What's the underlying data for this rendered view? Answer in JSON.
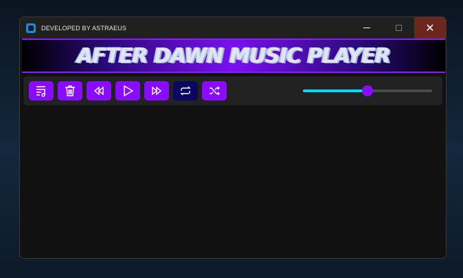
{
  "window": {
    "title": "DEVELOPED BY ASTRAEUS",
    "close_glyph": "✕"
  },
  "banner": {
    "title": "AFTER DAWN MUSIC PLAYER"
  },
  "toolbar": {
    "buttons": [
      {
        "name": "playlist",
        "icon": "playlist-icon"
      },
      {
        "name": "delete",
        "icon": "trash-icon"
      },
      {
        "name": "previous",
        "icon": "rewind-icon"
      },
      {
        "name": "play",
        "icon": "play-icon"
      },
      {
        "name": "next",
        "icon": "fast-forward-icon"
      },
      {
        "name": "repeat",
        "icon": "repeat-icon",
        "active": true
      },
      {
        "name": "shuffle",
        "icon": "shuffle-icon"
      }
    ],
    "volume_percent": 50
  },
  "colors": {
    "accent": "#8a0cff",
    "active": "#0b0660",
    "slider_fill": "#00d8ff",
    "close": "#6b261d"
  }
}
